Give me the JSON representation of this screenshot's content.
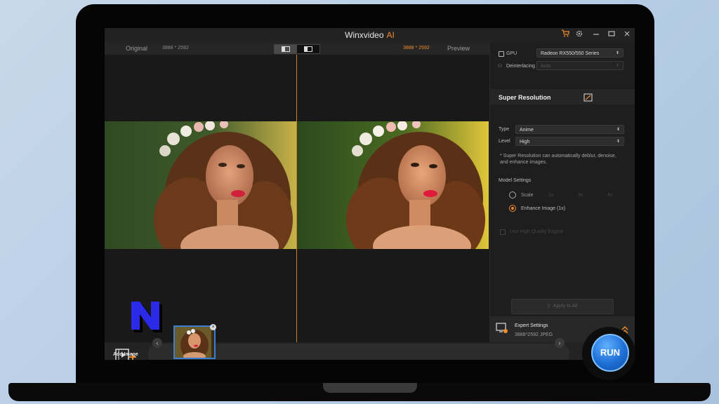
{
  "app": {
    "title": "Winxvideo",
    "title_accent": "AI"
  },
  "view": {
    "left_label": "Original",
    "left_res": "3888 * 2592",
    "right_res": "3888 * 2592",
    "right_label": "Preview"
  },
  "panel": {
    "gpu_label": "GPU",
    "gpu_value": "Radeon RX550/550 Series",
    "deinterlacing_label": "Deinterlacing",
    "deinterlacing_value": "Auto",
    "section_title": "Super Resolution",
    "type_label": "Type",
    "type_value": "Anime",
    "level_label": "Level",
    "level_value": "High",
    "note": "* Super Resolution can automatically deblur, denoise, and enhance images.",
    "model_settings_label": "Model Settings",
    "scale_label": "Scale",
    "scale_options": [
      "2x",
      "3x",
      "4x"
    ],
    "enhance_label": "Enhance Image (1x)",
    "hq_label": "Use High Quality Engine",
    "apply_all": "Apply to All",
    "expert_title": "Expert Settings",
    "expert_info": "3888*2592  JPEG"
  },
  "bottom": {
    "add_image": "Add Image",
    "run": "RUN",
    "logo_letter": "N"
  },
  "colors": {
    "accent": "#f08a2c",
    "run_blue": "#1f6fd6",
    "logo_blue": "#2a2ae8"
  }
}
